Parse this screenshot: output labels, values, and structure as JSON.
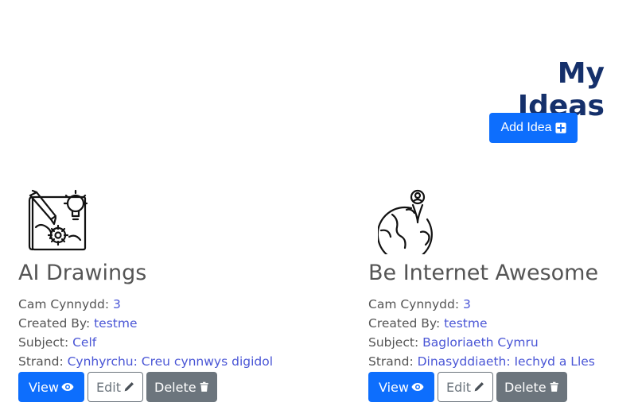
{
  "header": {
    "title": "My Ideas",
    "add_button_label": "Add Idea"
  },
  "ideas": [
    {
      "title": "AI Drawings",
      "icon": "drawing-blueprint-icon",
      "cam_label": "Cam Cynnydd:",
      "cam_value": "3",
      "created_label": "Created By:",
      "created_value": "testme",
      "subject_label": "Subject:",
      "subject_value": "Celf",
      "strand_label": "Strand:",
      "strand_value": "Cynhyrchu: Creu cynnwys digidol",
      "view_label": "View",
      "edit_label": "Edit",
      "delete_label": "Delete"
    },
    {
      "title": "Be Internet Awesome",
      "icon": "globe-person-icon",
      "cam_label": "Cam Cynnydd:",
      "cam_value": "3",
      "created_label": "Created By:",
      "created_value": "testme",
      "subject_label": "Subject:",
      "subject_value": "Bagloriaeth Cymru",
      "strand_label": "Strand:",
      "strand_value": "Dinasyddiaeth: Iechyd a Lles",
      "view_label": "View",
      "edit_label": "Edit",
      "delete_label": "Delete"
    }
  ],
  "colors": {
    "title": "#15306b",
    "primary": "#0d6efd",
    "secondary": "#6c757d",
    "link": "#4a56d6"
  }
}
